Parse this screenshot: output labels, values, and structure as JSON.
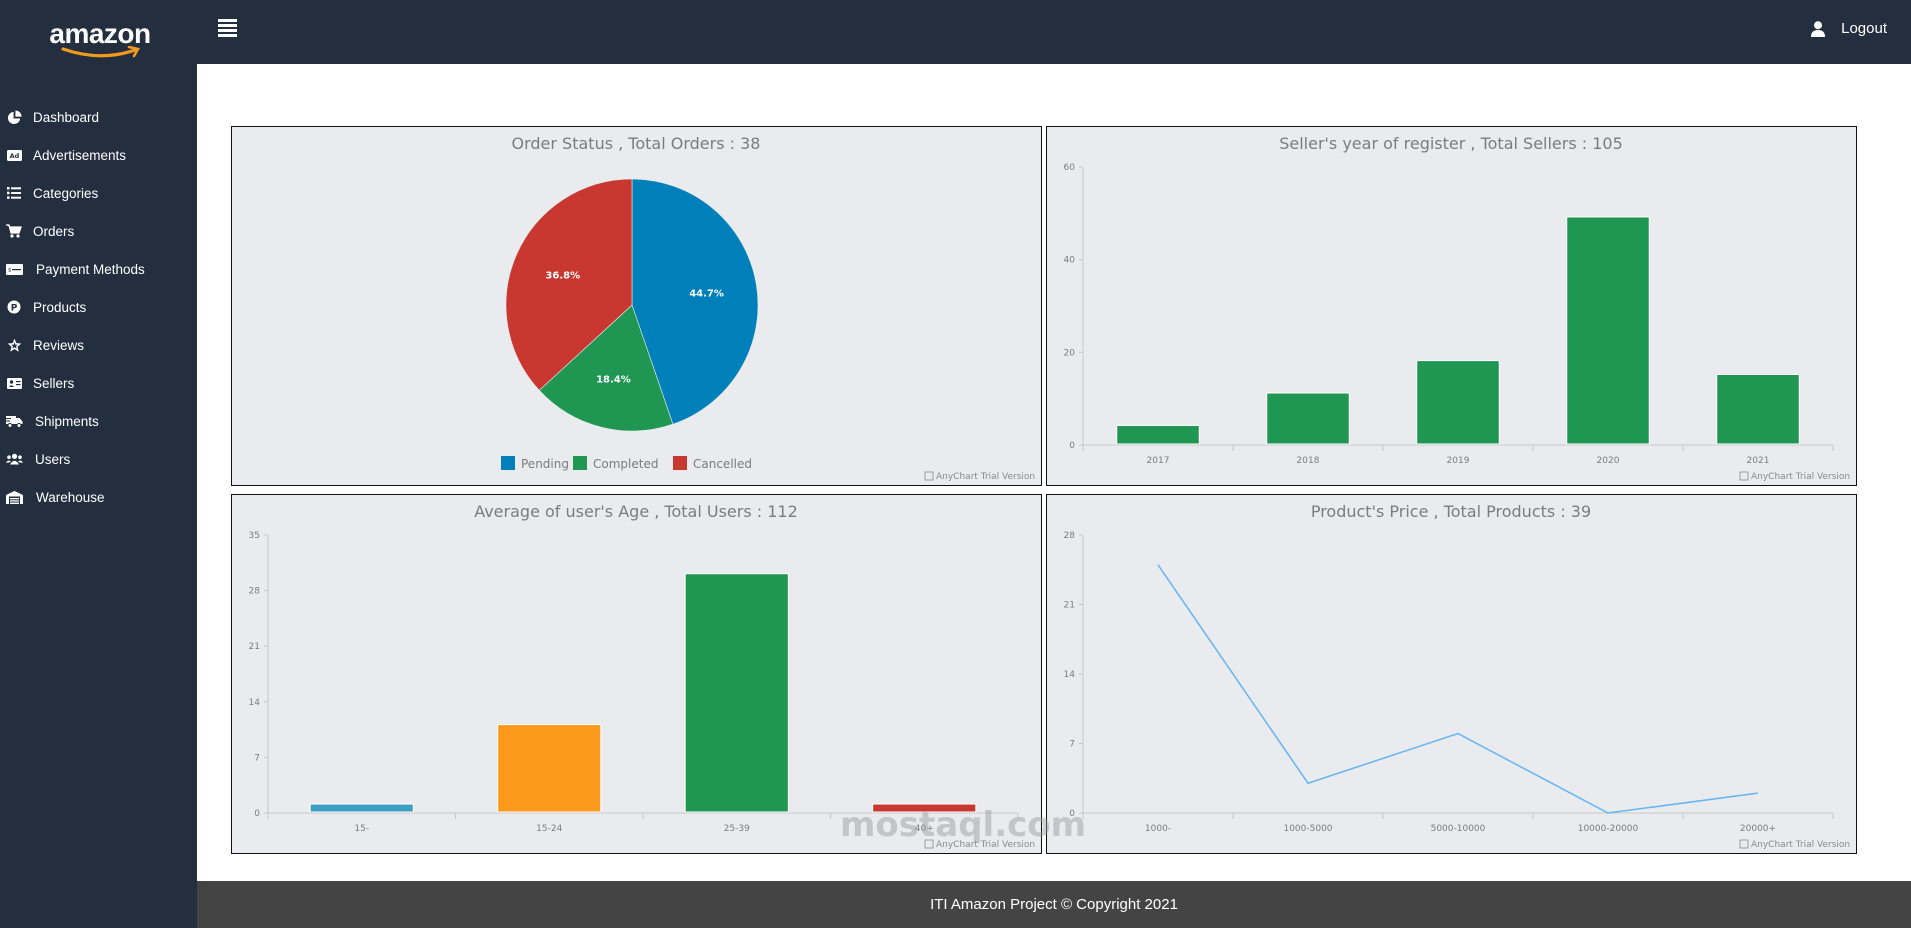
{
  "brand": {
    "name": "amazon"
  },
  "sidebar": {
    "items": [
      {
        "label": "Dashboard",
        "icon": "chart-pie-icon"
      },
      {
        "label": "Advertisements",
        "icon": "ad-icon"
      },
      {
        "label": "Categories",
        "icon": "list-icon"
      },
      {
        "label": "Orders",
        "icon": "shopping-cart-icon"
      },
      {
        "label": "Payment Methods",
        "icon": "money-check-icon"
      },
      {
        "label": "Products",
        "icon": "product-p-icon"
      },
      {
        "label": "Reviews",
        "icon": "star-icon"
      },
      {
        "label": "Sellers",
        "icon": "id-card-icon"
      },
      {
        "label": "Shipments",
        "icon": "shipping-truck-icon"
      },
      {
        "label": "Users",
        "icon": "users-icon"
      },
      {
        "label": "Warehouse",
        "icon": "warehouse-icon"
      }
    ]
  },
  "topbar": {
    "menu_icon": "hamburger-menu-icon",
    "logout_label": "Logout",
    "logout_icon": "user-icon"
  },
  "footer": {
    "text": "ITI Amazon Project © Copyright 2021"
  },
  "watermark": {
    "text": "mostaql.com"
  },
  "colors": {
    "sidebar": "#232f3e",
    "blue": "#0080bb",
    "green": "#1f9753",
    "red": "#c93830",
    "orange": "#fb991c",
    "teal": "#3a9fc3",
    "line": "#64b5f6"
  },
  "chart_data": [
    {
      "id": "orders",
      "type": "pie",
      "title": "Order Status , Total Orders : 38",
      "categories": [
        "Pending",
        "Completed",
        "Cancelled"
      ],
      "values": [
        17,
        7,
        14
      ],
      "labels": [
        "44.7%",
        "18.4%",
        "36.8%"
      ],
      "colors": [
        "#0080bb",
        "#1f9753",
        "#c93830"
      ],
      "legend": "bottom-center",
      "credit": "AnyChart Trial Version"
    },
    {
      "id": "sellers",
      "type": "bar",
      "title": "Seller's year of register , Total Sellers : 105",
      "categories": [
        "2017",
        "2018",
        "2019",
        "2020",
        "2021"
      ],
      "values": [
        4,
        11,
        18,
        49,
        15
      ],
      "colors": [
        "#1f9753",
        "#1f9753",
        "#1f9753",
        "#1f9753",
        "#1f9753"
      ],
      "ylim": [
        0,
        60
      ],
      "yticks": [
        0,
        20,
        40,
        60
      ],
      "credit": "AnyChart Trial Version"
    },
    {
      "id": "users",
      "type": "bar",
      "title": "Average of user's Age , Total Users : 112",
      "categories": [
        "15-",
        "15-24",
        "25-39",
        "40+"
      ],
      "values": [
        1,
        11,
        30,
        1
      ],
      "colors": [
        "#3a9fc3",
        "#fb991c",
        "#1f9753",
        "#c93830"
      ],
      "ylim": [
        0,
        35
      ],
      "yticks": [
        0,
        7,
        14,
        21,
        28,
        35
      ],
      "credit": "AnyChart Trial Version"
    },
    {
      "id": "products",
      "type": "line",
      "title": "Product's Price , Total Products : 39",
      "categories": [
        "1000-",
        "1000-5000",
        "5000-10000",
        "10000-20000",
        "20000+"
      ],
      "values": [
        25,
        3,
        8,
        0,
        2
      ],
      "colors": [
        "#64b5f6"
      ],
      "ylim": [
        0,
        28
      ],
      "yticks": [
        0,
        7,
        14,
        21,
        28
      ],
      "credit": "AnyChart Trial Version"
    }
  ]
}
